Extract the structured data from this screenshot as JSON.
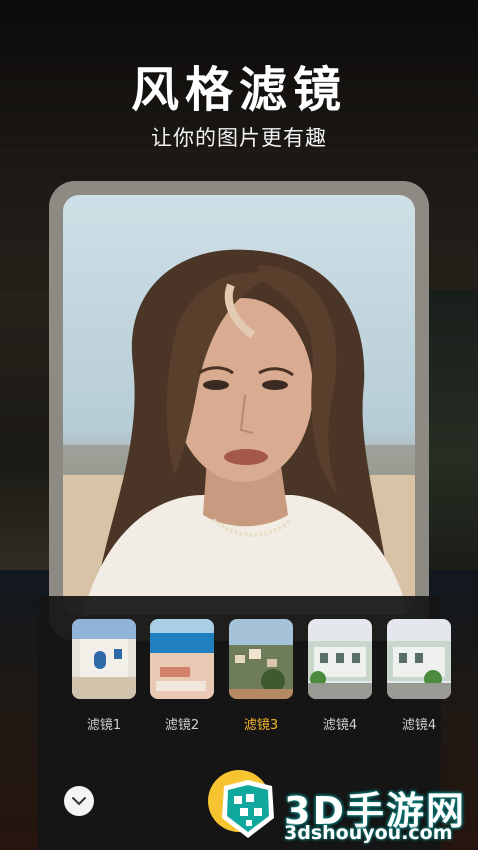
{
  "header": {
    "title": "风格滤镜",
    "subtitle": "让你的图片更有趣"
  },
  "filters": [
    {
      "label": "滤镜1",
      "active": false
    },
    {
      "label": "滤镜2",
      "active": false
    },
    {
      "label": "滤镜3",
      "active": true
    },
    {
      "label": "滤镜4",
      "active": false
    },
    {
      "label": "滤镜4",
      "active": false
    }
  ],
  "controls": {
    "collapse_icon": "chevron-down-icon"
  },
  "watermark": {
    "brand": "3D手游网",
    "url": "3dshouyou.com"
  },
  "colors": {
    "active_filter": "#f5b82e",
    "accent_button": "#f7c431",
    "watermark": "#0a7a78"
  }
}
